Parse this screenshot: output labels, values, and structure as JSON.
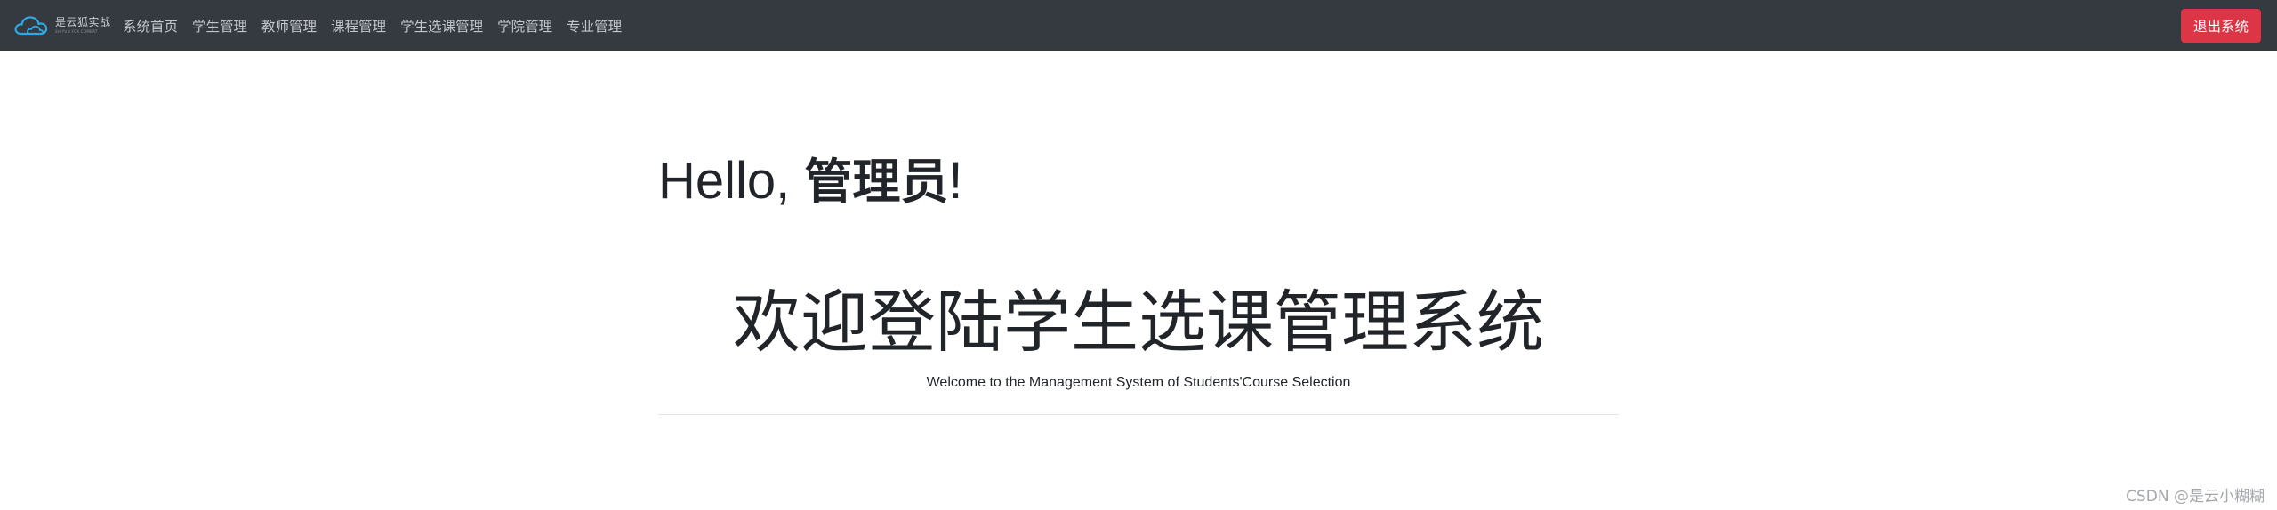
{
  "navbar": {
    "brand": {
      "title": "是云狐实战",
      "subtitle": "SHIYUN FOX COMBAT",
      "icon": "cloud-icon",
      "accent_color": "#2ea8e5"
    },
    "links": [
      {
        "label": "系统首页"
      },
      {
        "label": "学生管理"
      },
      {
        "label": "教师管理"
      },
      {
        "label": "课程管理"
      },
      {
        "label": "学生选课管理"
      },
      {
        "label": "学院管理"
      },
      {
        "label": "专业管理"
      }
    ],
    "logout_label": "退出系统",
    "background_color": "#343a40",
    "logout_color": "#dc3545"
  },
  "main": {
    "greeting_prefix": "Hello, ",
    "user_name": "管理员",
    "greeting_suffix": "!",
    "welcome_title": "欢迎登陆学生选课管理系统",
    "welcome_subtitle": "Welcome to the Management System of Students'Course Selection"
  },
  "watermark": "CSDN @是云小糊糊"
}
